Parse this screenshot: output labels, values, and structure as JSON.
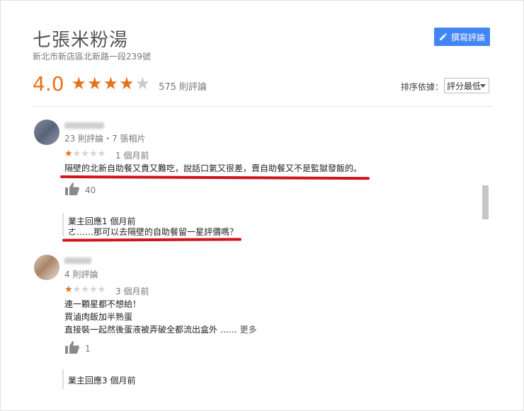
{
  "place": {
    "name": "七張米粉湯",
    "address": "新北市新店區北新路一段239號",
    "rating": "4.0",
    "rating_stars": 4,
    "review_count": "575 則評論"
  },
  "toolbar": {
    "write_review_label": "撰寫評論"
  },
  "sort": {
    "label": "排序依據：",
    "selected": "評分最低"
  },
  "colors": {
    "accent": "#4285f4",
    "star": "#e7711b",
    "highlight": "#d0141d"
  },
  "reviews": [
    {
      "meta": "23 則評論・7 張相片",
      "stars": 1,
      "when": "1 個月前",
      "text": "隔壁的北新自助餐又貴又難吃，說話口氣又很差，賣自助餐又不是監獄發飯的。",
      "likes": "40",
      "reply_header": "業主回應1 個月前",
      "reply_text": "ㄜ……那可以去隔壁的自助餐留一星評價嗎？"
    },
    {
      "meta": "4 則評論",
      "stars": 1,
      "when": "3 個月前",
      "lines": [
        "連一顆星都不想給！",
        "買滷肉飯加半熟蛋",
        "直接裝一起然後蛋液被弄破全都流出盒外 ……"
      ],
      "more": "更多",
      "likes": "1",
      "reply_header": "業主回應3 個月前"
    }
  ]
}
